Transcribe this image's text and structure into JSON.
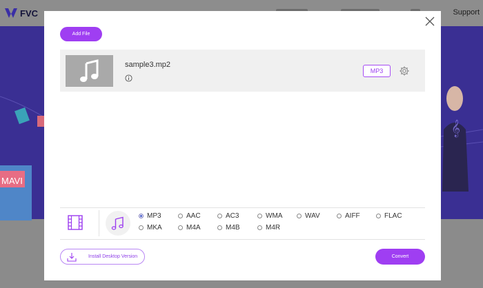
{
  "background": {
    "logo_text": "FVC",
    "nav_support": "Support",
    "deco_text": "MAVI"
  },
  "dialog": {
    "add_file_label": "Add File",
    "file": {
      "name": "sample3.mp2",
      "output_format": "MP3"
    },
    "formats": [
      {
        "label": "MP3",
        "selected": true
      },
      {
        "label": "AAC",
        "selected": false
      },
      {
        "label": "AC3",
        "selected": false
      },
      {
        "label": "WMA",
        "selected": false
      },
      {
        "label": "WAV",
        "selected": false
      },
      {
        "label": "AIFF",
        "selected": false
      },
      {
        "label": "FLAC",
        "selected": false
      },
      {
        "label": "MKA",
        "selected": false
      },
      {
        "label": "M4A",
        "selected": false
      },
      {
        "label": "M4B",
        "selected": false
      },
      {
        "label": "M4R",
        "selected": false
      }
    ],
    "install_label": "Install Desktop Version",
    "convert_label": "Convert"
  },
  "colors": {
    "accent": "#9f3ef2",
    "hero": "#3a2f93"
  },
  "icons": [
    "close-icon",
    "music-note-icon",
    "info-icon",
    "gear-icon",
    "film-icon",
    "download-icon"
  ]
}
